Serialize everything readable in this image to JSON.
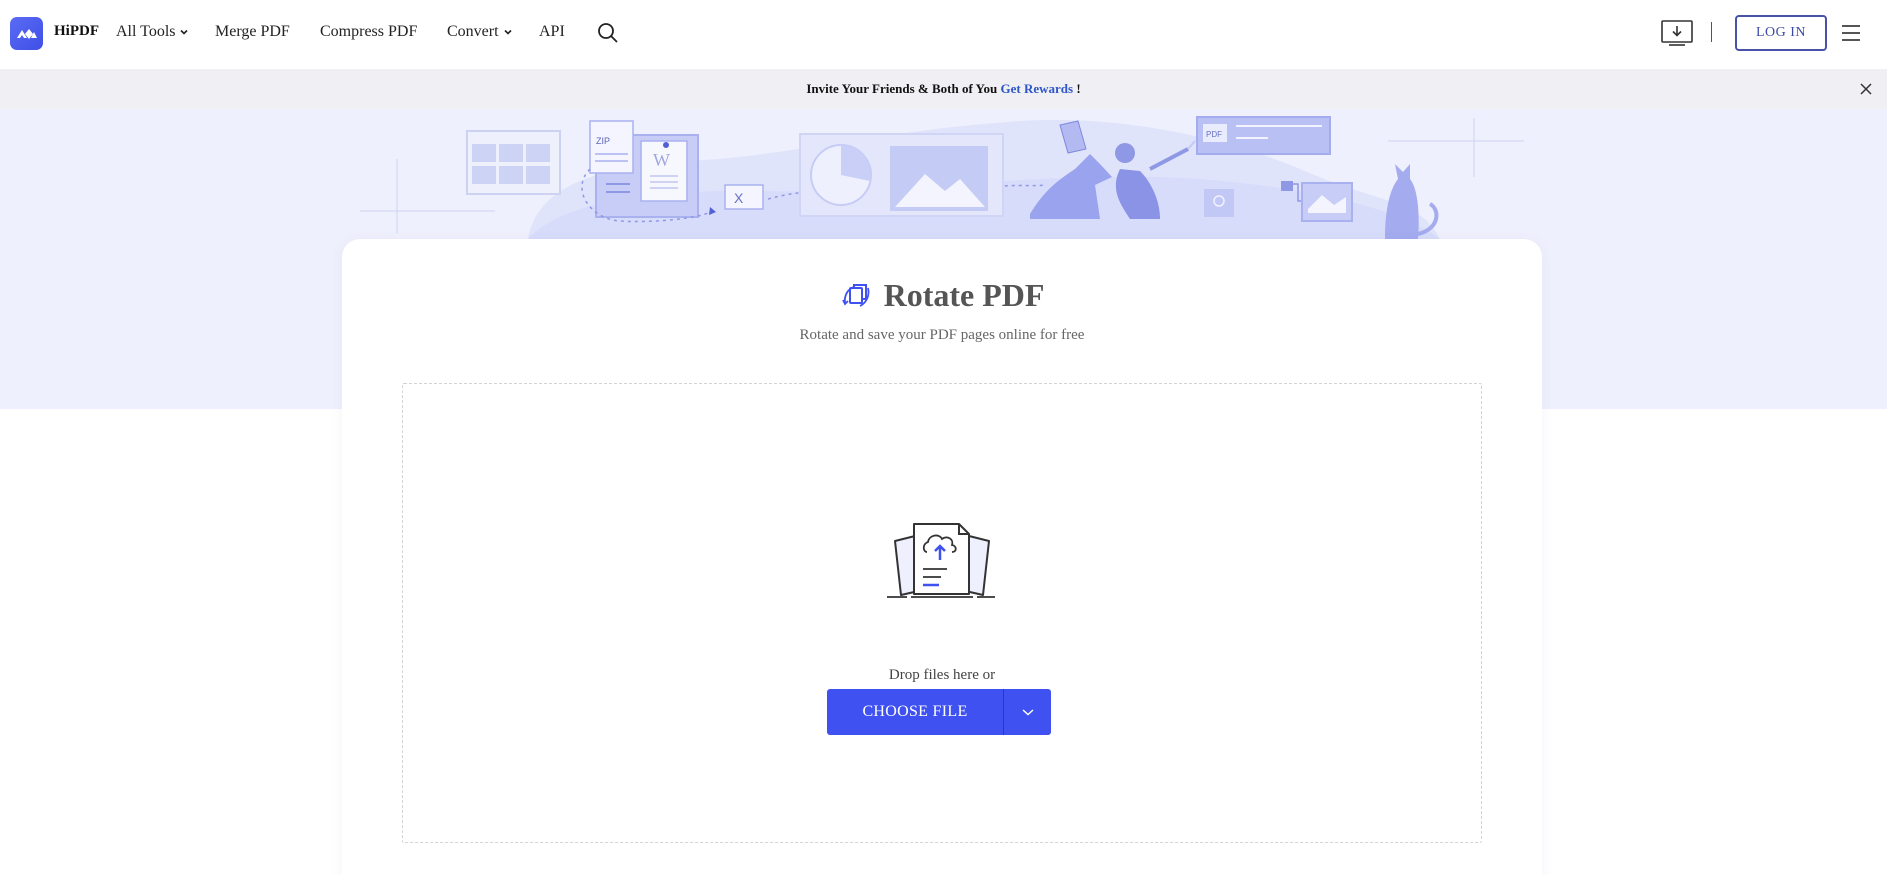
{
  "header": {
    "brand": "HiPDF",
    "nav": [
      {
        "label": "All Tools",
        "has_dropdown": true
      },
      {
        "label": "Merge PDF",
        "has_dropdown": false
      },
      {
        "label": "Compress PDF",
        "has_dropdown": false
      },
      {
        "label": "Convert",
        "has_dropdown": true
      },
      {
        "label": "API",
        "has_dropdown": false
      }
    ],
    "login_label": "LOG IN"
  },
  "promo": {
    "text": "Invite Your Friends & Both of You ",
    "link": "Get Rewards",
    "suffix": " !"
  },
  "tool": {
    "title": "Rotate PDF",
    "subtitle": "Rotate and save your PDF pages online for free"
  },
  "dropzone": {
    "prompt": "Drop files here or",
    "choose_label": "CHOOSE FILE"
  },
  "hero_labels": {
    "zip": "ZIP",
    "pdf": "PDF",
    "word": "W",
    "excel": "X"
  },
  "colors": {
    "accent": "#3f51f0",
    "link": "#2f56c6",
    "hero_bg": "#eef0fd",
    "login_border": "#4a52a8"
  },
  "icons": [
    "hipdf-logo-icon",
    "chevron-down-icon",
    "search-icon",
    "download-app-icon",
    "hamburger-menu-icon",
    "close-icon",
    "rotate-icon",
    "upload-cloud-icon"
  ]
}
